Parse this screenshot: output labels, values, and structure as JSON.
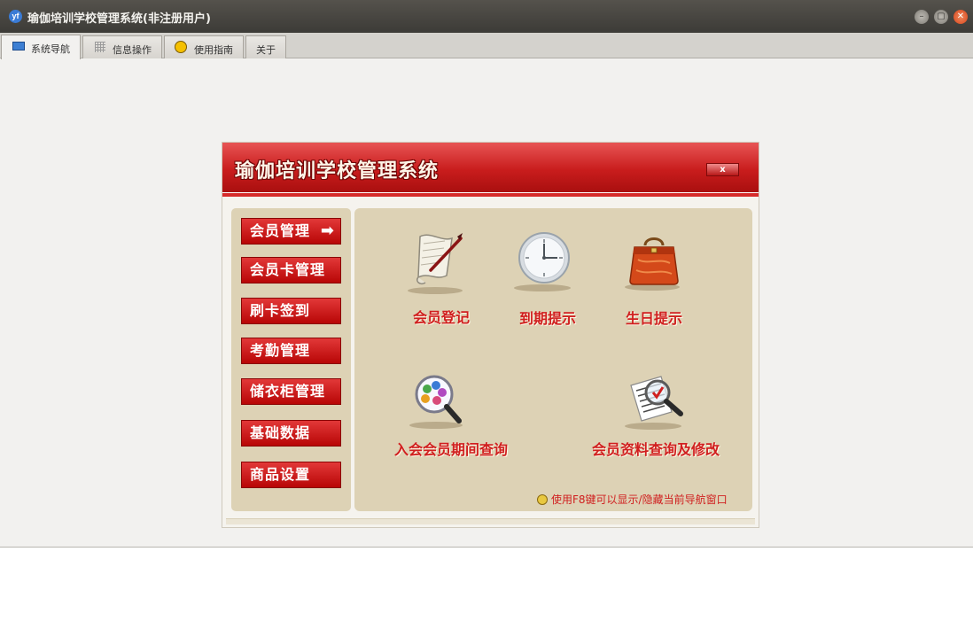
{
  "window": {
    "title": "瑜伽培训学校管理系统(非注册用户)",
    "app_icon": "yf"
  },
  "window_controls": {
    "minimize": "–",
    "maximize": "▢",
    "close": "✕"
  },
  "tabs": [
    {
      "label": "系统导航",
      "icon": "monitor-icon",
      "active": true
    },
    {
      "label": "信息操作",
      "icon": "grid-icon"
    },
    {
      "label": "使用指南",
      "icon": "guide-icon"
    },
    {
      "label": "关于"
    }
  ],
  "panel": {
    "title": "瑜伽培训学校管理系统",
    "close_label": "x",
    "sidebar_items": [
      {
        "label": "会员管理",
        "arrow": "➡"
      },
      {
        "label": "会员卡管理"
      },
      {
        "label": "刷卡签到"
      },
      {
        "label": "考勤管理"
      },
      {
        "label": "储衣柜管理"
      },
      {
        "label": "基础数据"
      },
      {
        "label": "商品设置"
      }
    ],
    "actions": [
      {
        "label": "会员登记",
        "icon": "scroll-quill-icon"
      },
      {
        "label": "到期提示",
        "icon": "clock-icon"
      },
      {
        "label": "生日提示",
        "icon": "handbag-icon"
      },
      {
        "label": "入会会员期间查询",
        "icon": "people-magnifier-icon"
      },
      {
        "label": "会员资料查询及修改",
        "icon": "document-magnifier-icon"
      }
    ],
    "hint": "使用F8键可以显示/隐藏当前导航窗口"
  },
  "colors": {
    "accent_red": "#d01f1f",
    "panel_bg": "#ddd2b5",
    "titlebar": "#3c3b37"
  }
}
